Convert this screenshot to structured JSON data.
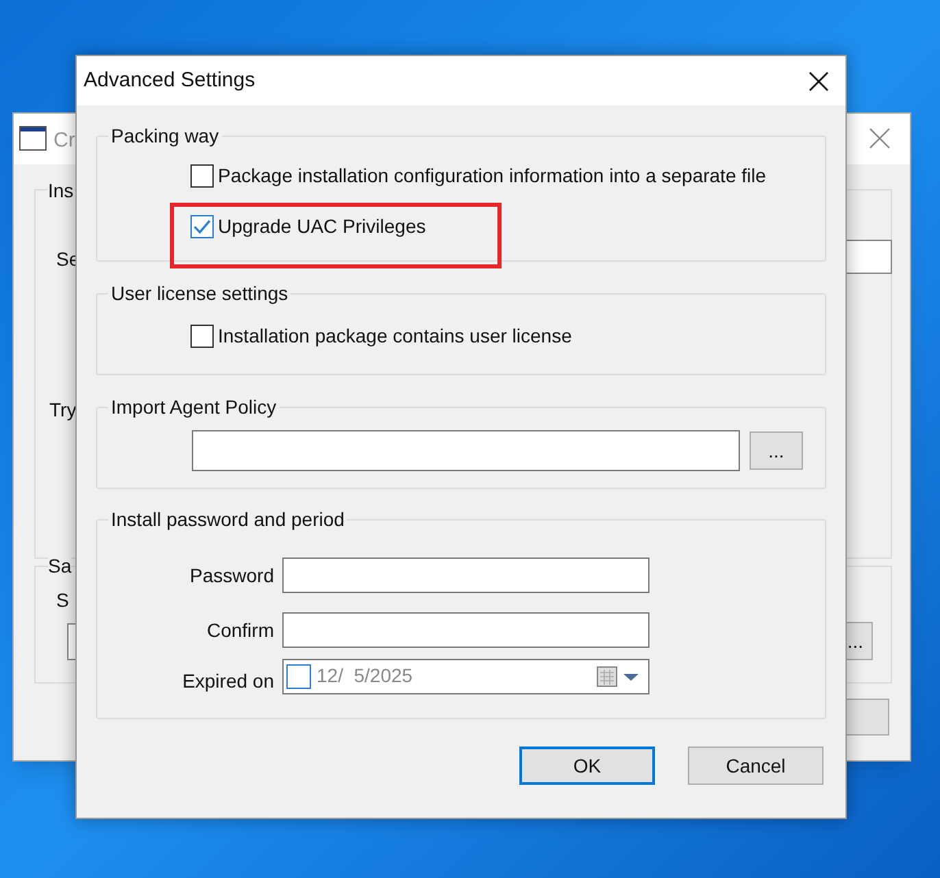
{
  "background_window": {
    "title": "Cr",
    "group_1": "Ins",
    "label_1": "Se",
    "group_2": "Try",
    "group_3": "Sa",
    "label_3": "S",
    "browse_button": "..."
  },
  "dialog": {
    "title": "Advanced Settings",
    "packing_way": {
      "title": "Packing way",
      "options": [
        {
          "label": "Package installation configuration information into a separate file",
          "checked": false,
          "highlighted": false
        },
        {
          "label": "Upgrade UAC Privileges",
          "checked": true,
          "highlighted": true
        }
      ]
    },
    "user_license": {
      "title": "User license settings",
      "options": [
        {
          "label": "Installation package contains user license",
          "checked": false,
          "highlighted": false
        }
      ]
    },
    "import_agent_policy": {
      "title": "Import Agent Policy",
      "browse_button": "..."
    },
    "install_password": {
      "title": "Install password and period",
      "password_label": "Password",
      "confirm_label": "Confirm",
      "expired_label": "Expired on",
      "expired_enabled": false,
      "date": "12/  5/2025"
    },
    "buttons": [
      {
        "label": "OK",
        "default": true
      },
      {
        "label": "Cancel",
        "default": false
      }
    ]
  }
}
